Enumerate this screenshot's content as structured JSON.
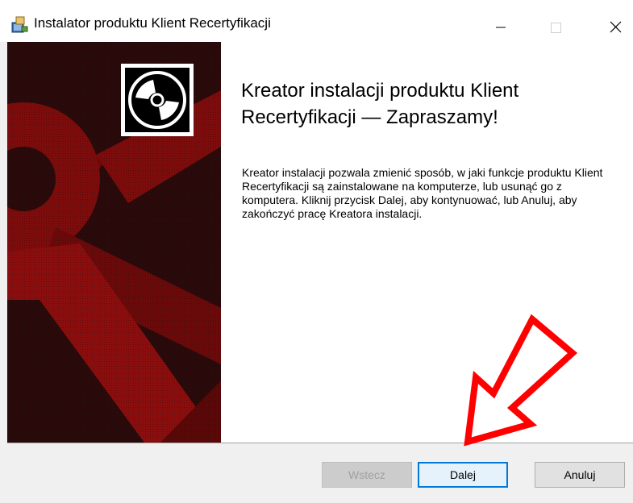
{
  "window": {
    "title": "Instalator produktu Klient Recertyfikacji",
    "icon": "installer-icon",
    "controls": [
      "minimize-icon",
      "maximize-icon",
      "close-icon"
    ]
  },
  "welcome": {
    "heading": "Kreator instalacji produktu Klient Recertyfikacji — Zapraszamy!",
    "description": "Kreator instalacji pozwala zmienić sposób, w jaki funkcje produktu Klient Recertyfikacji są zainstalowane na komputerze, lub usunąć go z komputera. Kliknij przycisk Dalej, aby kontynuować, lub Anuluj, aby zakończyć pracę Kreatora instalacji."
  },
  "buttons": {
    "back": "Wstecz",
    "next": "Dalej",
    "cancel": "Anuluj"
  },
  "colors": {
    "banner_dark": "#2a0a0a",
    "banner_red": "#8b0e0e",
    "accent_border": "#0078d7",
    "annotation_arrow": "#ff0000"
  }
}
